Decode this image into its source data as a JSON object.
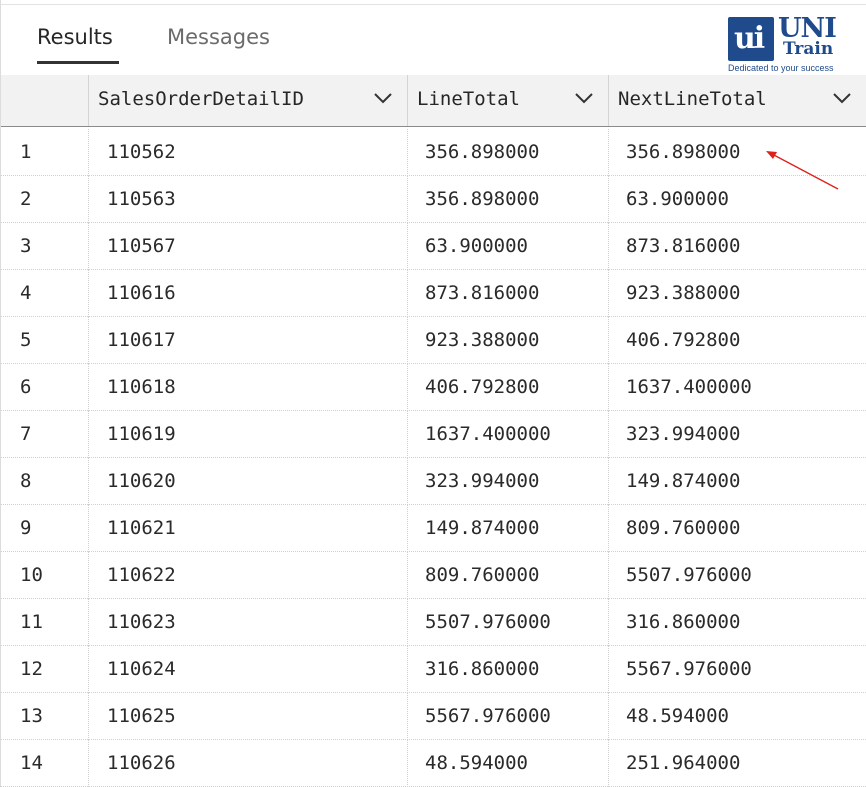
{
  "tabs": [
    {
      "label": "Results",
      "active": true
    },
    {
      "label": "Messages",
      "active": false
    }
  ],
  "logo": {
    "mark": "ui",
    "brand_top": "UNI",
    "brand_bottom": "Train",
    "tagline": "Dedicated to your success"
  },
  "columns": [
    {
      "label": ""
    },
    {
      "label": "SalesOrderDetailID"
    },
    {
      "label": "LineTotal"
    },
    {
      "label": "NextLineTotal"
    }
  ],
  "rows": [
    [
      "1",
      "110562",
      "356.898000",
      "356.898000"
    ],
    [
      "2",
      "110563",
      "356.898000",
      "63.900000"
    ],
    [
      "3",
      "110567",
      "63.900000",
      "873.816000"
    ],
    [
      "4",
      "110616",
      "873.816000",
      "923.388000"
    ],
    [
      "5",
      "110617",
      "923.388000",
      "406.792800"
    ],
    [
      "6",
      "110618",
      "406.792800",
      "1637.400000"
    ],
    [
      "7",
      "110619",
      "1637.400000",
      "323.994000"
    ],
    [
      "8",
      "110620",
      "323.994000",
      "149.874000"
    ],
    [
      "9",
      "110621",
      "149.874000",
      "809.760000"
    ],
    [
      "10",
      "110622",
      "809.760000",
      "5507.976000"
    ],
    [
      "11",
      "110623",
      "5507.976000",
      "316.860000"
    ],
    [
      "12",
      "110624",
      "316.860000",
      "5567.976000"
    ],
    [
      "13",
      "110625",
      "5567.976000",
      "48.594000"
    ],
    [
      "14",
      "110626",
      "48.594000",
      "251.964000"
    ]
  ],
  "icons": {
    "column_menu": "chevron-down-icon",
    "annotation": "red-arrow-icon"
  },
  "colors": {
    "accent": "#1f4a8c",
    "arrow": "#e0201c",
    "header_bg": "#f2f2f2"
  }
}
